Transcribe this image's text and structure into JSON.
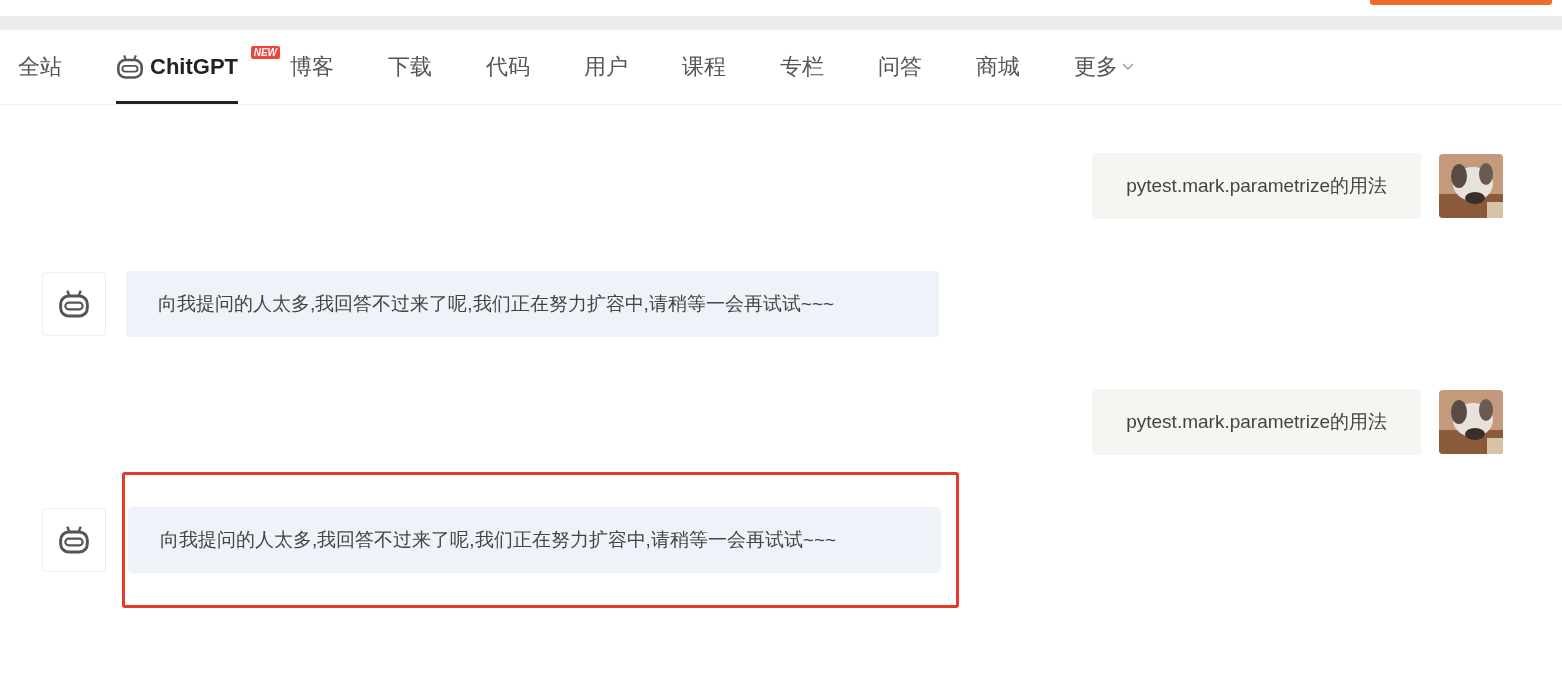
{
  "nav": {
    "tabs": [
      {
        "kind": "plain",
        "label": "全站",
        "selected": false
      },
      {
        "kind": "featured",
        "label": "ChitGPT",
        "selected": true,
        "badge": "NEW"
      },
      {
        "kind": "plain",
        "label": "博客",
        "selected": false
      },
      {
        "kind": "plain",
        "label": "下载",
        "selected": false
      },
      {
        "kind": "plain",
        "label": "代码",
        "selected": false
      },
      {
        "kind": "plain",
        "label": "用户",
        "selected": false
      },
      {
        "kind": "plain",
        "label": "课程",
        "selected": false
      },
      {
        "kind": "plain",
        "label": "专栏",
        "selected": false
      },
      {
        "kind": "plain",
        "label": "问答",
        "selected": false
      },
      {
        "kind": "plain",
        "label": "商城",
        "selected": false
      },
      {
        "kind": "dropdown",
        "label": "更多",
        "selected": false
      }
    ]
  },
  "messages": [
    {
      "kind": "user",
      "text": "pytest.mark.parametrize的用法"
    },
    {
      "kind": "bot",
      "text": "向我提问的人太多,我回答不过来了呢,我们正在努力扩容中,请稍等一会再试试~~~",
      "highlighted": false
    },
    {
      "kind": "user",
      "text": "pytest.mark.parametrize的用法"
    },
    {
      "kind": "bot",
      "text": "向我提问的人太多,我回答不过来了呢,我们正在努力扩容中,请稍等一会再试试~~~",
      "highlighted": true
    }
  ]
}
